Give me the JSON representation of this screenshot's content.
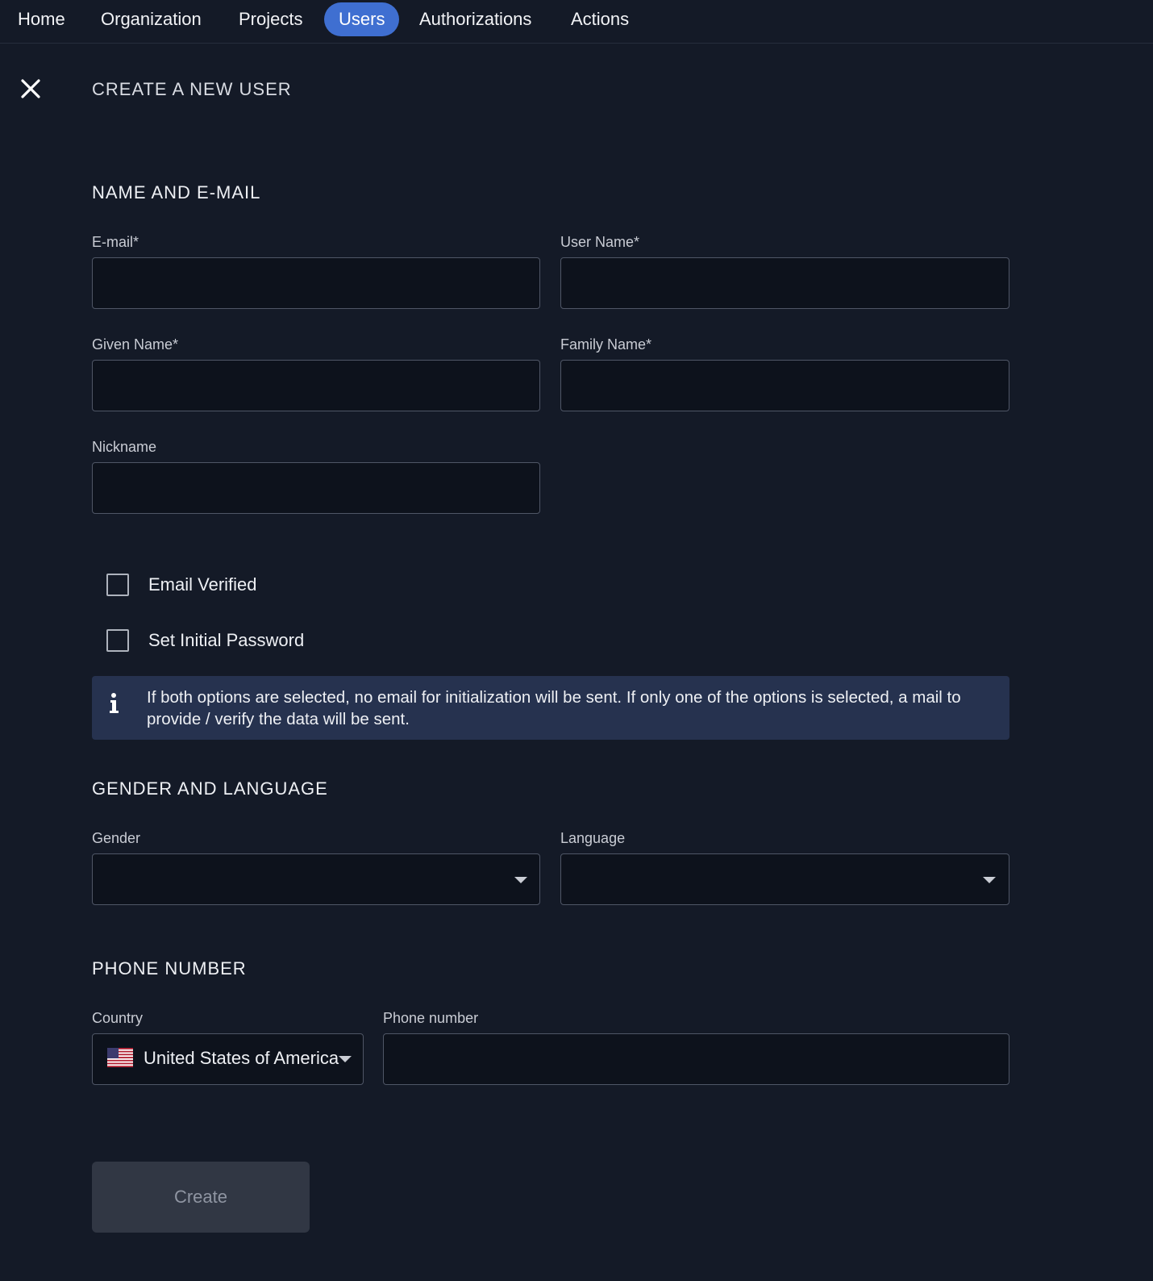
{
  "nav": {
    "items": [
      {
        "label": "Home"
      },
      {
        "label": "Organization"
      },
      {
        "label": "Projects"
      },
      {
        "label": "Users"
      },
      {
        "label": "Authorizations"
      },
      {
        "label": "Actions"
      }
    ],
    "active": "Users"
  },
  "page": {
    "title": "CREATE A NEW USER",
    "close_icon": "close-icon"
  },
  "name_section": {
    "title": "NAME AND E-MAIL",
    "email_label": "E-mail*",
    "email_value": "",
    "username_label": "User Name*",
    "username_value": "",
    "given_name_label": "Given Name*",
    "given_name_value": "",
    "family_name_label": "Family Name*",
    "family_name_value": "",
    "nickname_label": "Nickname",
    "nickname_value": ""
  },
  "options": {
    "email_verified_label": "Email Verified",
    "email_verified_checked": false,
    "initial_password_label": "Set Initial Password",
    "initial_password_checked": false,
    "info_icon": "info-icon",
    "info_text": "If both options are selected, no email for initialization will be sent. If only one of the options is selected, a mail to provide / verify the data will be sent."
  },
  "gender_section": {
    "title": "GENDER AND LANGUAGE",
    "gender_label": "Gender",
    "gender_value": "",
    "language_label": "Language",
    "language_value": ""
  },
  "phone_section": {
    "title": "PHONE NUMBER",
    "country_label": "Country",
    "country_value": "United States of America",
    "country_flag": "us-flag-icon",
    "phone_label": "Phone number",
    "phone_value": ""
  },
  "actions": {
    "create_label": "Create",
    "create_enabled": false
  },
  "colors": {
    "background": "#141a27",
    "accent": "#3f6fd1",
    "input_bg": "#0d121c",
    "info_bg": "#26324f",
    "disabled_button": "#313744"
  }
}
